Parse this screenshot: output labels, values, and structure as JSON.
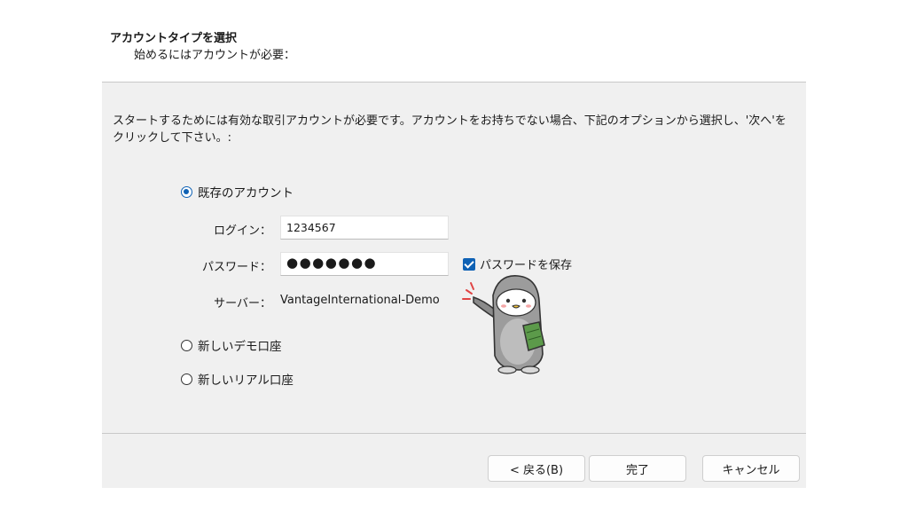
{
  "header": {
    "title": "アカウントタイプを選択",
    "subtitle": "始めるにはアカウントが必要："
  },
  "intro_text": "スタートするためには有効な取引アカウントが必要です。アカウントをお持ちでない場合、下記のオプションから選択し、'次へ'をクリックして下さい。:",
  "options": {
    "existing_account": "既存のアカウント",
    "new_demo": "新しいデモ口座",
    "new_real": "新しいリアル口座"
  },
  "form": {
    "login_label": "ログイン：",
    "login_value": "1234567",
    "password_label": "パスワード：",
    "password_value": "●●●●●●●",
    "save_password_label": "パスワードを保存",
    "server_label": "サーバー：",
    "server_value": "VantageInternational-Demo"
  },
  "footer": {
    "back_label": "< 戻る(B)",
    "finish_label": "完了",
    "cancel_label": "キャンセル"
  },
  "colors": {
    "accent": "#0f62b5",
    "panel_bg": "#f0f0f0"
  },
  "icons": [
    "radio-selected-icon",
    "radio-empty-icon",
    "checkbox-checked-icon",
    "penguin-mascot"
  ]
}
